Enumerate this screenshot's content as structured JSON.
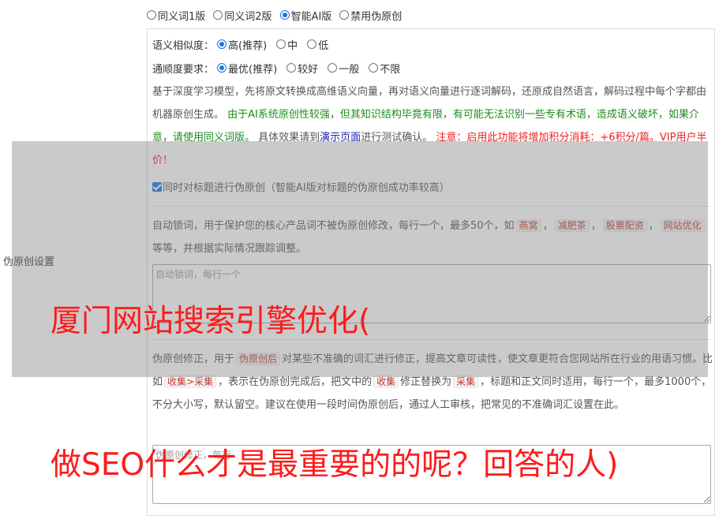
{
  "mode_options": [
    {
      "label": "同义词1版",
      "selected": false
    },
    {
      "label": "同义词2版",
      "selected": false
    },
    {
      "label": "智能AI版",
      "selected": true
    },
    {
      "label": "禁用伪原创",
      "selected": false
    }
  ],
  "side_label": "伪原创设置",
  "similarity": {
    "label": "语义相似度：",
    "options": [
      {
        "label": "高(推荐)",
        "selected": true
      },
      {
        "label": "中",
        "selected": false
      },
      {
        "label": "低",
        "selected": false
      }
    ]
  },
  "fluency": {
    "label": "通顺度要求：",
    "options": [
      {
        "label": "最优(推荐)",
        "selected": true
      },
      {
        "label": "较好",
        "selected": false
      },
      {
        "label": "一般",
        "selected": false
      },
      {
        "label": "不限",
        "selected": false
      }
    ]
  },
  "ai_desc": {
    "p1": "基于深度学习模型，先将原文转换成高维语义向量，再对语义向量进行逐词解码，还原成自然语言，解码过程中每个字都由机器原创生成。",
    "p2_green": "由于AI系统原创性较强，但其知识结构毕竟有限，有可能无法识别一些专有术语，造成语义破坏，如果介意，请使用同义词版。",
    "p3": "具体效果请到",
    "p3_link": "演示页面",
    "p3_end": "进行测试确认。",
    "p4_red": "注意：启用此功能将增加积分消耗：+6积分/篇。VIP用户半价！"
  },
  "title_checkbox": {
    "label": "同时对标题进行伪原创（智能AI版对标题的伪原创成功率较高）",
    "checked": true
  },
  "lock_words": {
    "desc_a": "自动锁词，用于保护您的核心产品词不被伪原创修改，每行一个，最多50个，如",
    "tags": [
      "燕窝",
      "减肥茶",
      "股票配资",
      "网站优化"
    ],
    "sep": "，",
    "desc_b": "等等，并根据实际情况跟踪调整。",
    "placeholder": "自动锁词，每行一个"
  },
  "correction": {
    "desc_a": "伪原创修正，用于",
    "tag1": "伪原创后",
    "desc_b": "对某些不准确的词汇进行修正，提高文章可读性，使文章更符合您网站所在行业的用语习惯。比如",
    "tag2": "收集>采集",
    "desc_c": "，表示在伪原创完成后，把文中的",
    "tag3": "收集",
    "desc_d": "修正替换为",
    "tag4": "采集",
    "desc_e": "，标题和正文同时适用，每行一个，最多1000个，不分大小写，默认留空。建议在使用一段时间伪原创后，通过人工审核，把常见的不准确词汇设置在此。",
    "placeholder": "伪原创修正，每行"
  },
  "watermark": {
    "line1": "厦门网站搜索引擎优化(",
    "line2": "做SEO什么才是最重要的的呢？回答的人)"
  },
  "colors": {
    "accent": "#1a73e8",
    "green_text": "#1e8c1e",
    "red_text": "#ee2222",
    "watermark": "#ff1a1a"
  }
}
